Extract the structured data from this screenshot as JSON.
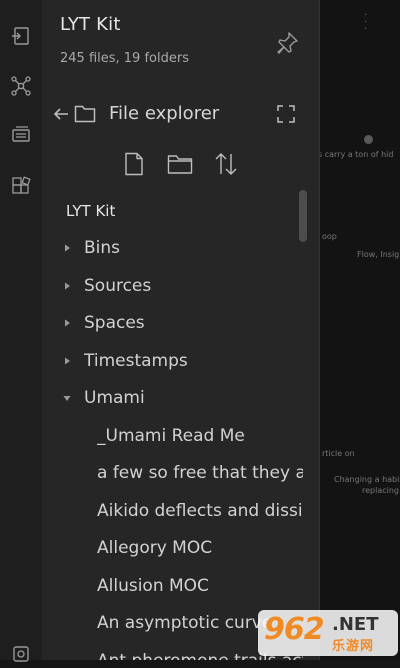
{
  "vault": {
    "name": "LYT Kit",
    "stats": "245 files, 19 folders"
  },
  "ribbon": {
    "items": [
      {
        "icon": "open-quick-switcher-icon"
      },
      {
        "icon": "graph-view-icon"
      },
      {
        "icon": "slides-icon"
      },
      {
        "icon": "plugins-icon"
      },
      {
        "icon": "vault-switcher-icon"
      }
    ]
  },
  "explorer": {
    "title": "File explorer",
    "tools": [
      "new-note-icon",
      "new-folder-icon",
      "sort-icon"
    ],
    "tree": [
      {
        "label": "LYT Kit",
        "kind": "root"
      },
      {
        "label": "Bins",
        "kind": "folder",
        "expanded": false
      },
      {
        "label": "Sources",
        "kind": "folder",
        "expanded": false
      },
      {
        "label": "Spaces",
        "kind": "folder",
        "expanded": false
      },
      {
        "label": "Timestamps",
        "kind": "folder",
        "expanded": false
      },
      {
        "label": "Umami",
        "kind": "folder",
        "expanded": true
      },
      {
        "label": "_Umami Read Me",
        "kind": "file"
      },
      {
        "label": "a few so free that they a",
        "kind": "file"
      },
      {
        "label": "Aikido deflects and dissip",
        "kind": "file"
      },
      {
        "label": "Allegory MOC",
        "kind": "file"
      },
      {
        "label": "Allusion MOC",
        "kind": "file"
      },
      {
        "label": "An asymptotic curve",
        "kind": "file"
      },
      {
        "label": "Ant pheromone trails act",
        "kind": "file"
      }
    ]
  },
  "graph": {
    "fragments": [
      "s carry a ton of hid",
      "oop",
      "Flow, Insig",
      "rticle on",
      "Changing a habi",
      "replacing"
    ]
  },
  "watermark": {
    "number": "962",
    "domain": ".NET",
    "text_cn": "乐游网"
  },
  "colors": {
    "panel_bg": "#262626",
    "ribbon_bg": "#1e1e1e",
    "text": "#dcddde",
    "muted": "#a9a9a9",
    "accent": "#f08a24"
  }
}
